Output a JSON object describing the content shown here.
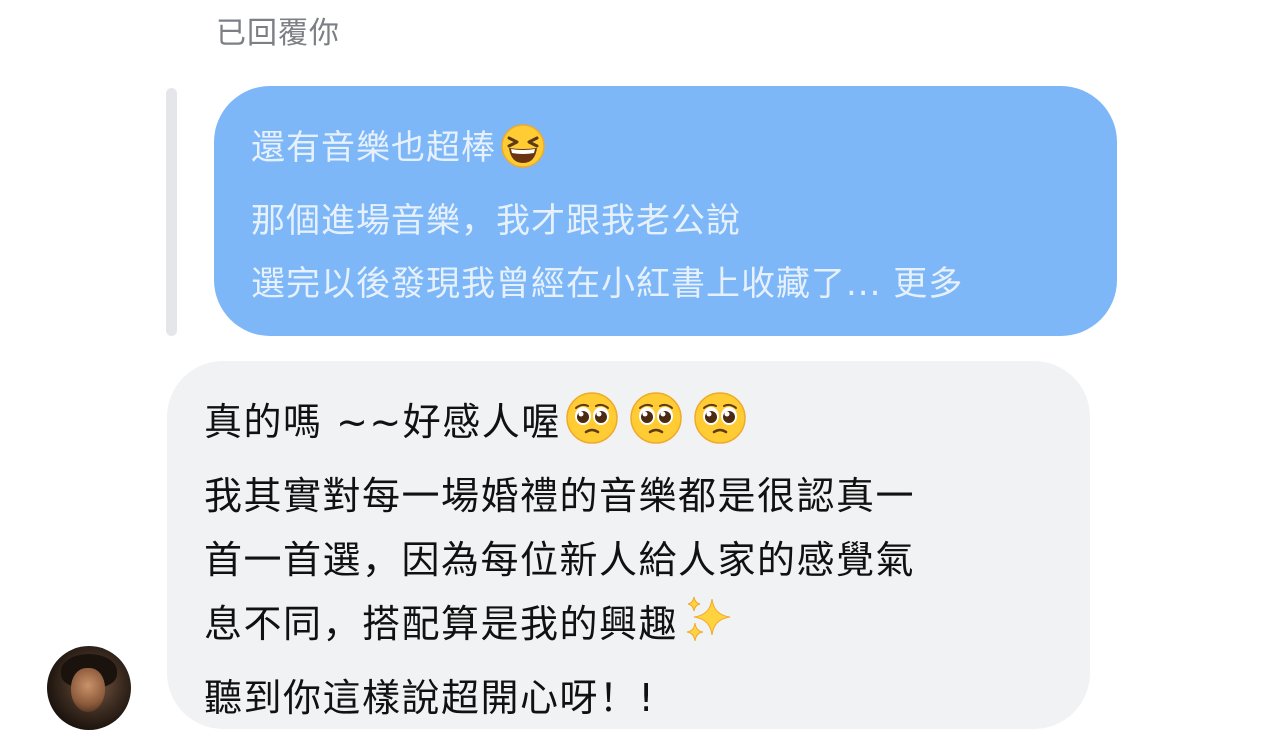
{
  "header": {
    "replied_label": "已回覆你"
  },
  "quoted_message": {
    "lines": [
      "還有音樂也超棒",
      "那個進場音樂，我才跟我老公說",
      "選完以後發現我曾經在小紅書上收藏了... 更多"
    ],
    "line1_emoji": "grinning-squinting-face-icon",
    "bubble_color": "#7db7f8"
  },
  "reply_message": {
    "lines": [
      "真的嗎 ~~好感人喔",
      "我其實對每一場婚禮的音樂都是很認真一",
      "首一首選，因為每位新人給人家的感覺氣",
      "息不同，搭配算是我的興趣",
      "聽到你這樣說超開心呀！!"
    ],
    "line1_emojis": [
      "pleading-face-icon",
      "pleading-face-icon",
      "pleading-face-icon"
    ],
    "line4_emoji": "sparkles-icon",
    "bubble_color": "#f1f2f4"
  },
  "sender": {
    "avatar_icon": "avatar"
  }
}
